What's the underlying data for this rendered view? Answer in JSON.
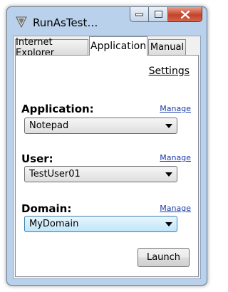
{
  "window": {
    "title": "RunAsTestUs...",
    "accent": "#b9d1ea"
  },
  "caption_buttons": {
    "minimize_icon": "minimize-icon",
    "maximize_icon": "maximize-icon",
    "close_icon": "close-icon"
  },
  "tabs": [
    {
      "label": "Internet Explorer",
      "active": false
    },
    {
      "label": "Application",
      "active": true
    },
    {
      "label": "Manual",
      "active": false
    }
  ],
  "settings_link": "Settings",
  "fields": {
    "application": {
      "label": "Application:",
      "manage": "Manage",
      "value": "Notepad"
    },
    "user": {
      "label": "User:",
      "manage": "Manage",
      "value": "TestUser01"
    },
    "domain": {
      "label": "Domain:",
      "manage": "Manage",
      "value": "MyDomain"
    }
  },
  "launch_label": "Launch"
}
